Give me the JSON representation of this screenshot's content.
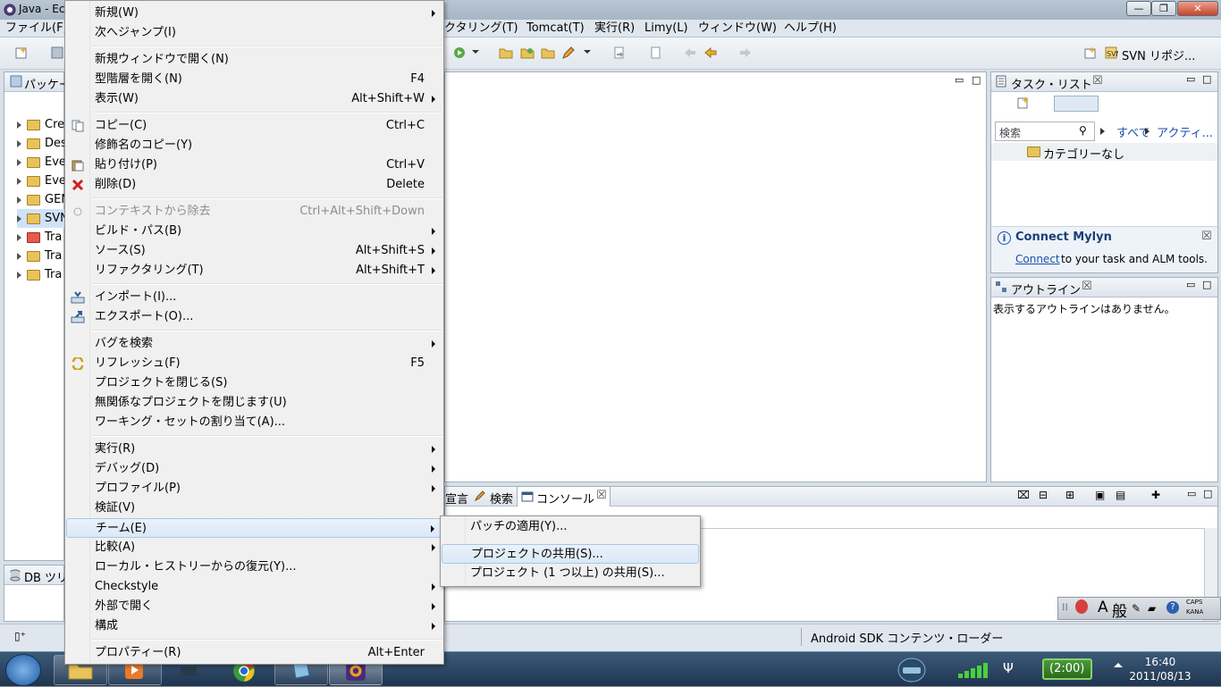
{
  "window": {
    "title": "Java - Ec",
    "buttons": {
      "minimize": "—",
      "maximize": "❐",
      "close": "✕"
    }
  },
  "menubar": {
    "items": [
      "ファイル(F)",
      "クタリング(T)",
      "Tomcat(T)",
      "実行(R)",
      "Limy(L)",
      "ウィンドウ(W)",
      "ヘルプ(H)"
    ]
  },
  "toolbar": {
    "svn_perspective": "SVN リポジ..."
  },
  "package_explorer": {
    "tab": "パッケー",
    "items": [
      {
        "label": "Cre",
        "icon": "project-folder-icon"
      },
      {
        "label": "Des",
        "icon": "project-folder-icon"
      },
      {
        "label": "Eve",
        "icon": "project-folder-icon"
      },
      {
        "label": "Eve",
        "icon": "project-folder-icon"
      },
      {
        "label": "GEN",
        "icon": "project-folder-icon"
      },
      {
        "label": "SVN",
        "icon": "project-folder-icon"
      },
      {
        "label": "Tra",
        "icon": "project-folder-icon"
      },
      {
        "label": "Tra",
        "icon": "project-folder-icon"
      },
      {
        "label": "Tra",
        "icon": "project-folder-icon"
      }
    ]
  },
  "db_panel": {
    "tab": "DB ツリ"
  },
  "task_list": {
    "tab": "タスク・リスト",
    "search_placeholder": "検索",
    "filter_all": "すべて",
    "filter_active": "アクティ...",
    "category": "カテゴリーなし",
    "mylyn_title": "Connect Mylyn",
    "mylyn_link": "Connect",
    "mylyn_text": "to your task and ALM tools."
  },
  "outline": {
    "tab": "アウトライン",
    "empty_text": "表示するアウトラインはありません。"
  },
  "bottom_panel": {
    "tab_decl": "宣言",
    "tab_search": "検索",
    "tab_console": "コンソール"
  },
  "statusbar": {
    "task": "Android SDK コンテンツ・ローダー"
  },
  "context_menu": {
    "items": [
      {
        "label": "新規(W)",
        "shortcut": "",
        "submenu": true
      },
      {
        "label": "次へジャンプ(I)",
        "shortcut": "",
        "submenu": false
      },
      {
        "label": "新規ウィンドウで開く(N)",
        "shortcut": "",
        "submenu": false
      },
      {
        "label": "型階層を開く(N)",
        "shortcut": "F4",
        "submenu": false
      },
      {
        "label": "表示(W)",
        "shortcut": "Alt+Shift+W",
        "submenu": true
      },
      {
        "label": "コピー(C)",
        "shortcut": "Ctrl+C",
        "submenu": false
      },
      {
        "label": "修飾名のコピー(Y)",
        "shortcut": "",
        "submenu": false
      },
      {
        "label": "貼り付け(P)",
        "shortcut": "Ctrl+V",
        "submenu": false
      },
      {
        "label": "削除(D)",
        "shortcut": "Delete",
        "submenu": false
      },
      {
        "label": "コンテキストから除去",
        "shortcut": "Ctrl+Alt+Shift+Down",
        "submenu": false
      },
      {
        "label": "ビルド・パス(B)",
        "shortcut": "",
        "submenu": true
      },
      {
        "label": "ソース(S)",
        "shortcut": "Alt+Shift+S",
        "submenu": true
      },
      {
        "label": "リファクタリング(T)",
        "shortcut": "Alt+Shift+T",
        "submenu": true
      },
      {
        "label": "インポート(I)...",
        "shortcut": "",
        "submenu": false
      },
      {
        "label": "エクスポート(O)...",
        "shortcut": "",
        "submenu": false
      },
      {
        "label": "バグを検索",
        "shortcut": "",
        "submenu": true
      },
      {
        "label": "リフレッシュ(F)",
        "shortcut": "F5",
        "submenu": false
      },
      {
        "label": "プロジェクトを閉じる(S)",
        "shortcut": "",
        "submenu": false
      },
      {
        "label": "無関係なプロジェクトを閉じます(U)",
        "shortcut": "",
        "submenu": false
      },
      {
        "label": "ワーキング・セットの割り当て(A)...",
        "shortcut": "",
        "submenu": false
      },
      {
        "label": "実行(R)",
        "shortcut": "",
        "submenu": true
      },
      {
        "label": "デバッグ(D)",
        "shortcut": "",
        "submenu": true
      },
      {
        "label": "プロファイル(P)",
        "shortcut": "",
        "submenu": true
      },
      {
        "label": "検証(V)",
        "shortcut": "",
        "submenu": false
      },
      {
        "label": "チーム(E)",
        "shortcut": "",
        "submenu": true
      },
      {
        "label": "比較(A)",
        "shortcut": "",
        "submenu": true
      },
      {
        "label": "ローカル・ヒストリーからの復元(Y)...",
        "shortcut": "",
        "submenu": false
      },
      {
        "label": "Checkstyle",
        "shortcut": "",
        "submenu": true
      },
      {
        "label": "外部で開く",
        "shortcut": "",
        "submenu": true
      },
      {
        "label": "構成",
        "shortcut": "",
        "submenu": true
      },
      {
        "label": "プロパティー(R)",
        "shortcut": "Alt+Enter",
        "submenu": false
      }
    ]
  },
  "team_submenu": {
    "items": [
      "パッチの適用(Y)...",
      "プロジェクトの共用(S)...",
      "プロジェクト (1 つ以上) の共用(S)..."
    ]
  },
  "ime_bar": {
    "mode": "A",
    "kanji": "般",
    "caps": "CAPS",
    "kana": "KANA"
  },
  "taskbar": {
    "battery": "(2:00)",
    "time": "16:40",
    "date": "2011/08/13"
  }
}
